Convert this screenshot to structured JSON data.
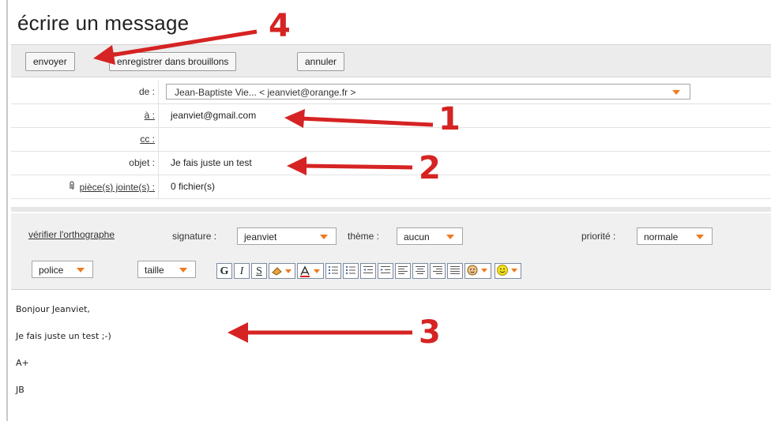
{
  "page": {
    "title": "écrire un message"
  },
  "toolbar": {
    "send": "envoyer",
    "save_draft": "enregistrer dans brouillons",
    "cancel": "annuler"
  },
  "headers": {
    "from_label": "de :",
    "from_value": "Jean-Baptiste Vie... < jeanviet@orange.fr >",
    "to_label": "à :",
    "to_value": "jeanviet@gmail.com",
    "cc_label": "cc :",
    "cc_value": "",
    "subject_label": "objet :",
    "subject_value": "Je fais juste un test",
    "attach_label": "pièce(s) jointe(s) :",
    "attach_value": "0 fichier(s)"
  },
  "editor_toolbar": {
    "spellcheck": "vérifier l'orthographe",
    "signature_label": "signature :",
    "signature_value": "jeanviet",
    "theme_label": "thème :",
    "theme_value": "aucun",
    "priority_label": "priorité :",
    "priority_value": "normale",
    "font": "police",
    "size": "taille",
    "bold": "G",
    "italic": "I",
    "underline": "S"
  },
  "message_body": {
    "line1": "Bonjour Jeanviet,",
    "line2": "Je fais juste un test ;-)",
    "line3": "A+",
    "line4": "JB"
  },
  "annotations": {
    "n1": "1",
    "n2": "2",
    "n3": "3",
    "n4": "4",
    "color": "#d62323"
  }
}
